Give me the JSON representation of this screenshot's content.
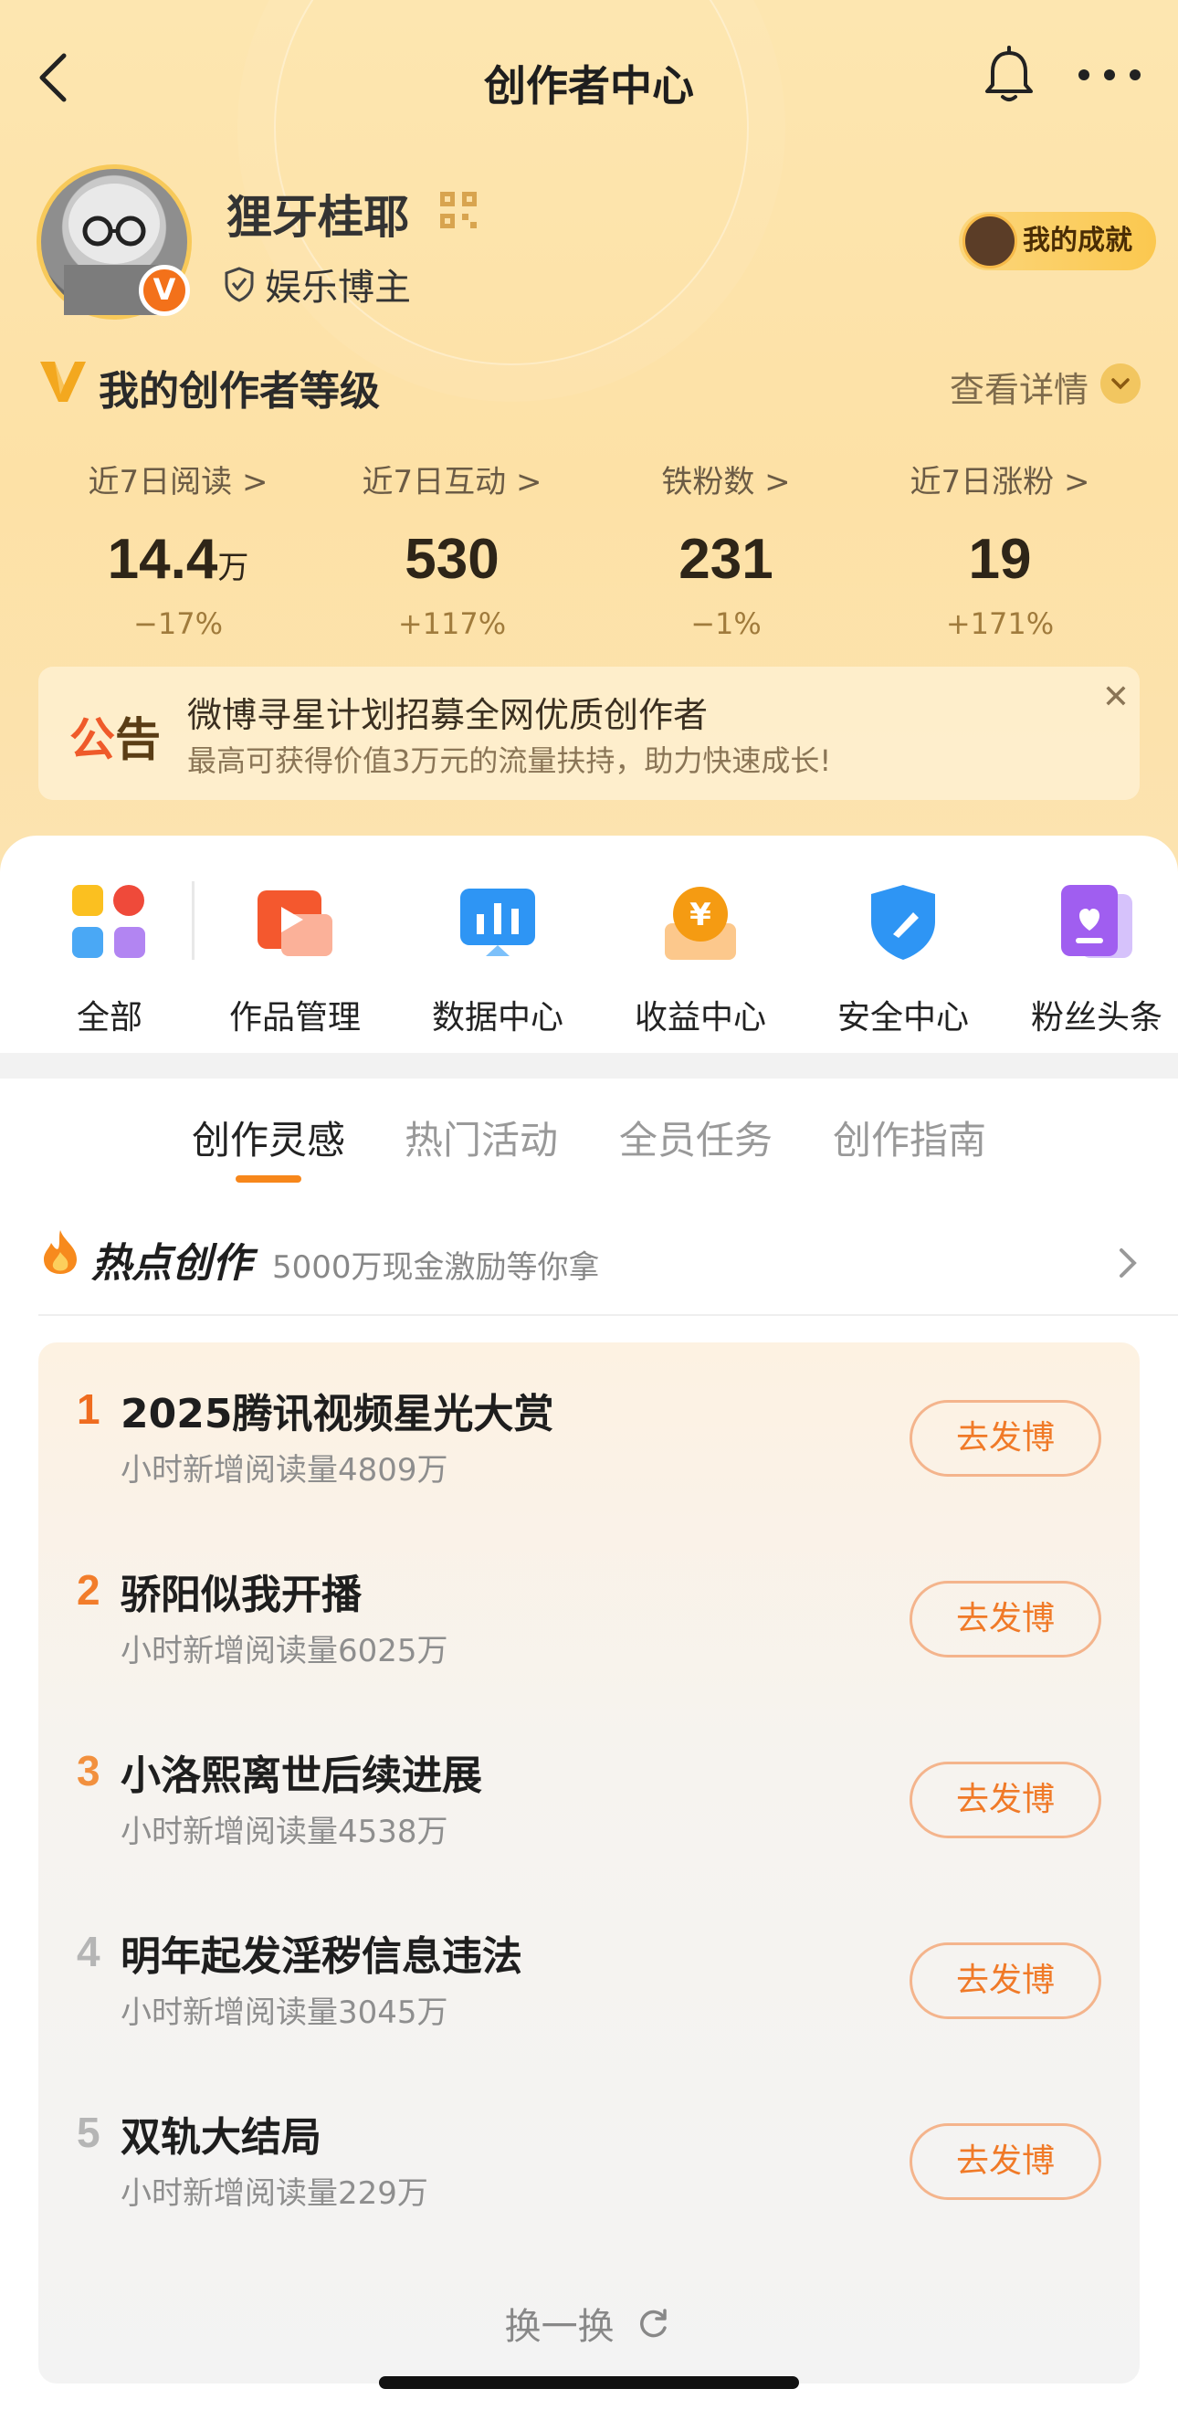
{
  "nav": {
    "title": "创作者中心"
  },
  "profile": {
    "name": "狸牙桂耶",
    "role": "娱乐博主",
    "badge": "V",
    "achievement": "我的成就"
  },
  "level": {
    "title": "我的创作者等级",
    "more": "查看详情"
  },
  "stats": [
    {
      "label": "近7日阅读 >",
      "value": "14.4",
      "unit": "万",
      "change": "−17%"
    },
    {
      "label": "近7日互动 >",
      "value": "530",
      "unit": "",
      "change": "+117%"
    },
    {
      "label": "铁粉数 >",
      "value": "231",
      "unit": "",
      "change": "−1%"
    },
    {
      "label": "近7日涨粉 >",
      "value": "19",
      "unit": "",
      "change": "+171%"
    }
  ],
  "notice": {
    "tag1": "公",
    "tag2": "告",
    "line1": "微博寻星计划招募全网优质创作者",
    "line2": "最高可获得价值3万元的流量扶持，助力快速成长!"
  },
  "tools": [
    {
      "label": "全部"
    },
    {
      "label": "作品管理"
    },
    {
      "label": "数据中心"
    },
    {
      "label": "收益中心"
    },
    {
      "label": "安全中心"
    },
    {
      "label": "粉丝头条"
    }
  ],
  "tabs": [
    "创作灵感",
    "热门活动",
    "全员任务",
    "创作指南"
  ],
  "hot": {
    "title": "热点创作",
    "subtitle": "5000万现金激励等你拿"
  },
  "items": [
    {
      "rank": "1",
      "title": "2025腾讯视频星光大赏",
      "sub": "小时新增阅读量4809万",
      "btn": "去发博",
      "color": "#ef6c1f"
    },
    {
      "rank": "2",
      "title": "骄阳似我开播",
      "sub": "小时新增阅读量6025万",
      "btn": "去发博",
      "color": "#f27d2b"
    },
    {
      "rank": "3",
      "title": "小洛熙离世后续进展",
      "sub": "小时新增阅读量4538万",
      "btn": "去发博",
      "color": "#f2903e"
    },
    {
      "rank": "4",
      "title": "明年起发淫秽信息违法",
      "sub": "小时新增阅读量3045万",
      "btn": "去发博",
      "color": "#b5b5b5"
    },
    {
      "rank": "5",
      "title": "双轨大结局",
      "sub": "小时新增阅读量229万",
      "btn": "去发博",
      "color": "#b5b5b5"
    }
  ],
  "refresh": "换一换"
}
